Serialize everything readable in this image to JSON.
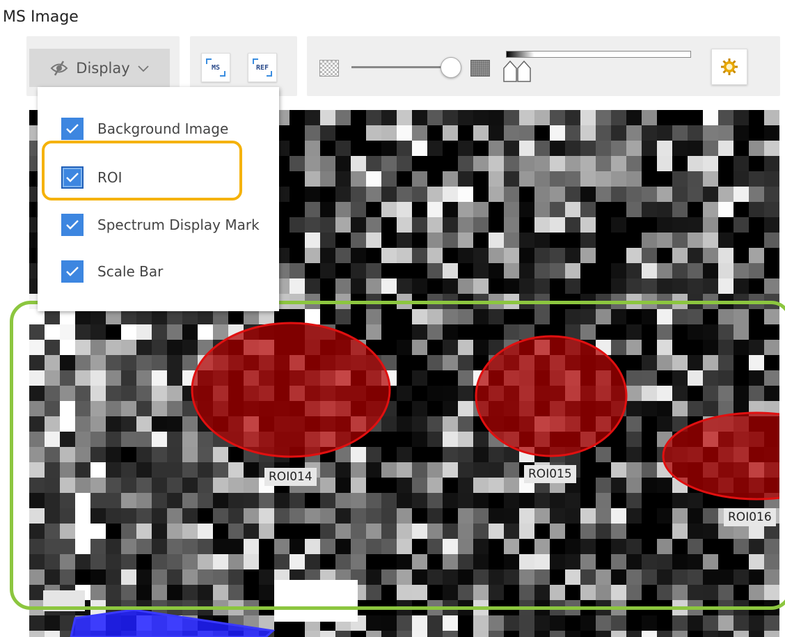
{
  "window": {
    "title": "MS Image"
  },
  "toolbar": {
    "display_label": "Display",
    "ms_label": "MS",
    "ref_label": "REF",
    "opacity_slider_value": 0.88
  },
  "dropdown": {
    "items": [
      {
        "label": "Background Image",
        "checked": true
      },
      {
        "label": "ROI",
        "checked": true
      },
      {
        "label": "Spectrum Display Mark",
        "checked": true
      },
      {
        "label": "Scale Bar",
        "checked": true
      }
    ]
  },
  "rois": [
    {
      "label": "ROI014"
    },
    {
      "label": "ROI015"
    },
    {
      "label": "ROI016"
    }
  ],
  "colors": {
    "checkbox": "#3d86e0",
    "roi_fill": "#b00000",
    "roi_stroke": "#e01010",
    "highlight_orange": "#f5b20a",
    "highlight_green": "#8cc63f",
    "blue_shape": "#1a1aff"
  },
  "icons": {
    "display": "eye-slash-icon",
    "settings": "sun-gear-icon",
    "transparent": "checker-icon",
    "opaque": "solid-square-icon"
  }
}
